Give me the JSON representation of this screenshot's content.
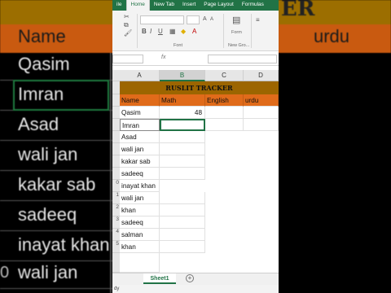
{
  "ribbon_tabs": [
    "ile",
    "Home",
    "New Tab",
    "Insert",
    "Page Layout",
    "Formulas"
  ],
  "ribbon_groups": {
    "font": "Font",
    "new_group": "New Gro..."
  },
  "ribbon_buttons": {
    "form": "Form"
  },
  "formula_bar": {
    "fx": "fx",
    "value": ""
  },
  "columns": [
    "A",
    "B",
    "C",
    "D"
  ],
  "selected_column": "B",
  "title": "RUSLIT TRACKER",
  "headers": [
    "Name",
    "Math",
    "English",
    "urdu"
  ],
  "rows": [
    {
      "name": "Qasim",
      "math": "48"
    },
    {
      "name": "Imran",
      "math": ""
    },
    {
      "name": "Asad",
      "math": ""
    },
    {
      "name": "wali jan",
      "math": ""
    },
    {
      "name": "kakar sab",
      "math": ""
    },
    {
      "name": "sadeeq",
      "math": ""
    },
    {
      "name": "inayat khan",
      "math": ""
    },
    {
      "name": "wali jan",
      "math": ""
    },
    {
      "name": "khan",
      "math": ""
    },
    {
      "name": "sadeeq",
      "math": ""
    },
    {
      "name": "salman",
      "math": ""
    },
    {
      "name": "khan",
      "math": ""
    }
  ],
  "row_numbers": [
    "",
    "",
    "",
    "",
    "",
    "",
    "",
    "",
    "0",
    "1",
    "2",
    "3",
    "4",
    "5",
    ""
  ],
  "sheet_tab": "Sheet1",
  "status": "dy",
  "background": {
    "title_fragment": "ER",
    "headers": [
      "Name",
      "urdu"
    ],
    "names": [
      "Qasim",
      "Imran",
      "Asad",
      "wali jan",
      "kakar sab",
      "sadeeq",
      "inayat khan",
      "wali jan"
    ],
    "row_numbers": [
      "",
      "",
      "",
      "",
      "",
      "",
      "",
      "0"
    ]
  },
  "colors": {
    "title_fill": "#9c6500",
    "header_fill": "#e06b1a",
    "excel_green": "#217346"
  }
}
